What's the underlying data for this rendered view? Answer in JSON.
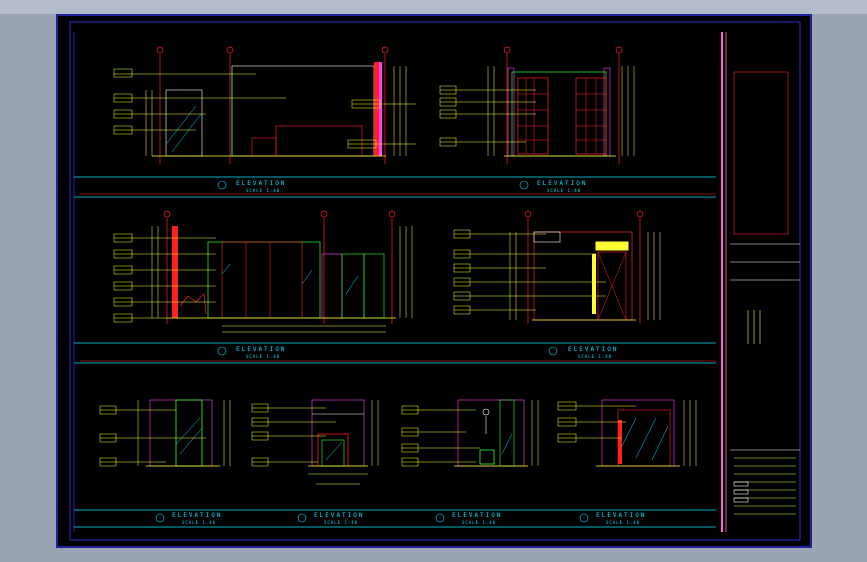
{
  "elevations": [
    {
      "id": "top-left",
      "label": "ELEVATION",
      "scale": "SCALE 1:40"
    },
    {
      "id": "top-right",
      "label": "ELEVATION",
      "scale": "SCALE 1:40"
    },
    {
      "id": "mid-left",
      "label": "ELEVATION",
      "scale": "SCALE 1:40"
    },
    {
      "id": "mid-right",
      "label": "ELEVATION",
      "scale": "SCALE 1:40"
    },
    {
      "id": "bot-1",
      "label": "ELEVATION",
      "scale": "SCALE 1:40"
    },
    {
      "id": "bot-2",
      "label": "ELEVATION",
      "scale": "SCALE 1:40"
    },
    {
      "id": "bot-3",
      "label": "ELEVATION",
      "scale": "SCALE 1:40"
    },
    {
      "id": "bot-4",
      "label": "ELEVATION",
      "scale": "SCALE 1:40"
    }
  ],
  "colors": {
    "frame": "#3a3aff",
    "cyan": "#00e6ff",
    "yellow": "#ffff33",
    "red": "#ff2020",
    "magenta": "#ff44ff",
    "green": "#33ff33",
    "white": "#ffffff",
    "pink": "#ff66cc"
  }
}
